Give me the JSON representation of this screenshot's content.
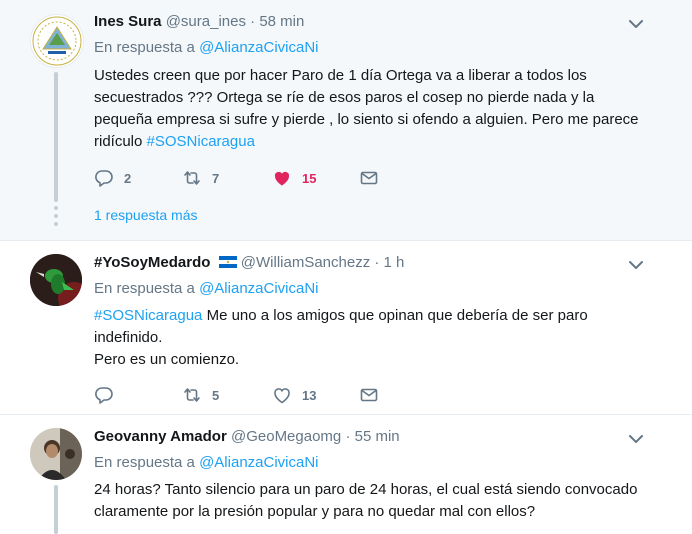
{
  "tweets": [
    {
      "name": "Ines Sura",
      "handle": "@sura_ines",
      "dot": "·",
      "time": "58 min",
      "reply_prefix": "En respuesta a",
      "reply_to": "@AlianzaCivicaNi",
      "text": "Ustedes creen que por hacer Paro de 1 día Ortega va a liberar a todos los secuestrados ??? Ortega se ríe de esos paros el cosep no pierde nada y la pequeña empresa si sufre y pierde , lo siento si ofendo a alguien. Pero me parece ridículo ",
      "hashtag": "#SOSNicaragua",
      "replies": "2",
      "retweets": "7",
      "likes": "15",
      "liked": true,
      "more_replies": "1 respuesta más"
    },
    {
      "name": "#YoSoyMedardo",
      "handle": "@WilliamSanchezz",
      "dot": "·",
      "time": "1 h",
      "reply_prefix": "En respuesta a",
      "reply_to": "@AlianzaCivicaNi",
      "hashtag": "#SOSNicaragua",
      "text_line1": " Me uno a los amigos que opinan que debería de ser paro indefinido.",
      "text_line2": "Pero es un comienzo.",
      "replies": "",
      "retweets": "5",
      "likes": "13",
      "liked": false
    },
    {
      "name": "Geovanny Amador",
      "handle": "@GeoMegaomg",
      "dot": "·",
      "time": "55 min",
      "reply_prefix": "En respuesta a",
      "reply_to": "@AlianzaCivicaNi",
      "text": "24 horas? Tanto silencio para un paro de 24 horas, el cual está siendo convocado claramente por la presión popular y para no quedar mal con ellos?"
    }
  ],
  "colors": {
    "link": "#1da1f2",
    "secondary": "#657786",
    "like_active": "#e0245e",
    "thread_line": "#c4cfd6"
  }
}
